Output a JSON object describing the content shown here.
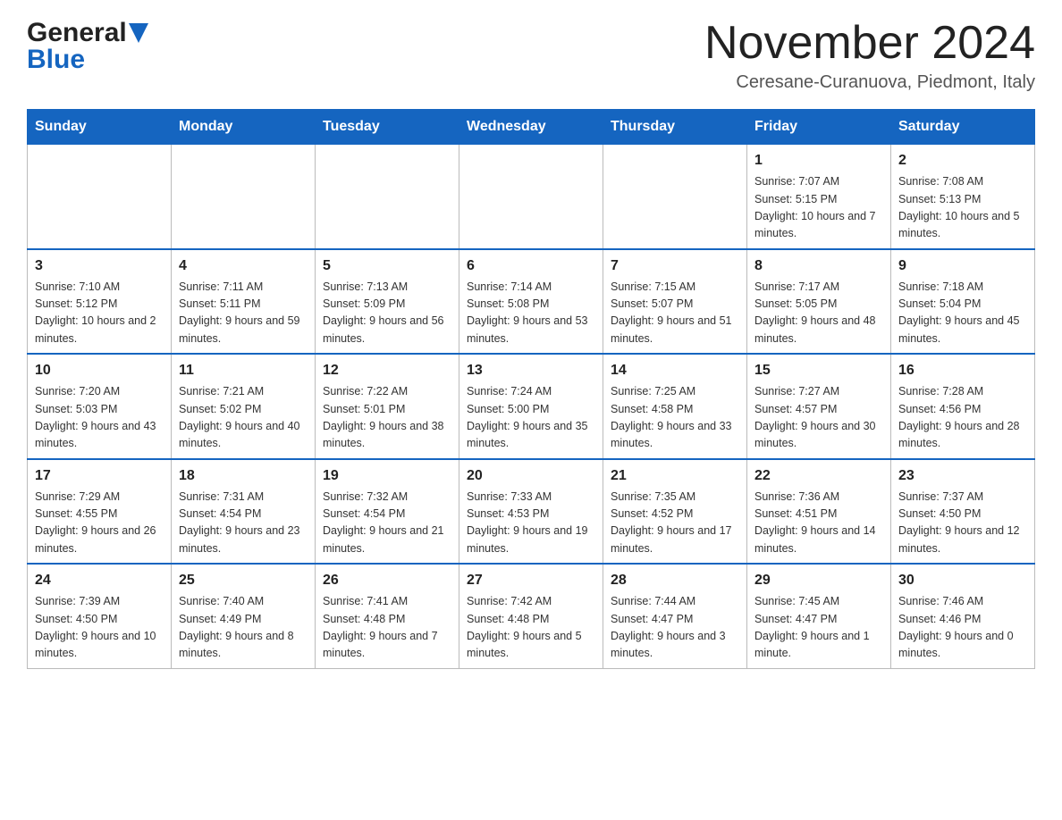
{
  "logo": {
    "general": "General",
    "blue": "Blue"
  },
  "title": "November 2024",
  "subtitle": "Ceresane-Curanuova, Piedmont, Italy",
  "header": {
    "days": [
      "Sunday",
      "Monday",
      "Tuesday",
      "Wednesday",
      "Thursday",
      "Friday",
      "Saturday"
    ]
  },
  "weeks": [
    [
      {
        "day": "",
        "info": ""
      },
      {
        "day": "",
        "info": ""
      },
      {
        "day": "",
        "info": ""
      },
      {
        "day": "",
        "info": ""
      },
      {
        "day": "",
        "info": ""
      },
      {
        "day": "1",
        "info": "Sunrise: 7:07 AM\nSunset: 5:15 PM\nDaylight: 10 hours and 7 minutes."
      },
      {
        "day": "2",
        "info": "Sunrise: 7:08 AM\nSunset: 5:13 PM\nDaylight: 10 hours and 5 minutes."
      }
    ],
    [
      {
        "day": "3",
        "info": "Sunrise: 7:10 AM\nSunset: 5:12 PM\nDaylight: 10 hours and 2 minutes."
      },
      {
        "day": "4",
        "info": "Sunrise: 7:11 AM\nSunset: 5:11 PM\nDaylight: 9 hours and 59 minutes."
      },
      {
        "day": "5",
        "info": "Sunrise: 7:13 AM\nSunset: 5:09 PM\nDaylight: 9 hours and 56 minutes."
      },
      {
        "day": "6",
        "info": "Sunrise: 7:14 AM\nSunset: 5:08 PM\nDaylight: 9 hours and 53 minutes."
      },
      {
        "day": "7",
        "info": "Sunrise: 7:15 AM\nSunset: 5:07 PM\nDaylight: 9 hours and 51 minutes."
      },
      {
        "day": "8",
        "info": "Sunrise: 7:17 AM\nSunset: 5:05 PM\nDaylight: 9 hours and 48 minutes."
      },
      {
        "day": "9",
        "info": "Sunrise: 7:18 AM\nSunset: 5:04 PM\nDaylight: 9 hours and 45 minutes."
      }
    ],
    [
      {
        "day": "10",
        "info": "Sunrise: 7:20 AM\nSunset: 5:03 PM\nDaylight: 9 hours and 43 minutes."
      },
      {
        "day": "11",
        "info": "Sunrise: 7:21 AM\nSunset: 5:02 PM\nDaylight: 9 hours and 40 minutes."
      },
      {
        "day": "12",
        "info": "Sunrise: 7:22 AM\nSunset: 5:01 PM\nDaylight: 9 hours and 38 minutes."
      },
      {
        "day": "13",
        "info": "Sunrise: 7:24 AM\nSunset: 5:00 PM\nDaylight: 9 hours and 35 minutes."
      },
      {
        "day": "14",
        "info": "Sunrise: 7:25 AM\nSunset: 4:58 PM\nDaylight: 9 hours and 33 minutes."
      },
      {
        "day": "15",
        "info": "Sunrise: 7:27 AM\nSunset: 4:57 PM\nDaylight: 9 hours and 30 minutes."
      },
      {
        "day": "16",
        "info": "Sunrise: 7:28 AM\nSunset: 4:56 PM\nDaylight: 9 hours and 28 minutes."
      }
    ],
    [
      {
        "day": "17",
        "info": "Sunrise: 7:29 AM\nSunset: 4:55 PM\nDaylight: 9 hours and 26 minutes."
      },
      {
        "day": "18",
        "info": "Sunrise: 7:31 AM\nSunset: 4:54 PM\nDaylight: 9 hours and 23 minutes."
      },
      {
        "day": "19",
        "info": "Sunrise: 7:32 AM\nSunset: 4:54 PM\nDaylight: 9 hours and 21 minutes."
      },
      {
        "day": "20",
        "info": "Sunrise: 7:33 AM\nSunset: 4:53 PM\nDaylight: 9 hours and 19 minutes."
      },
      {
        "day": "21",
        "info": "Sunrise: 7:35 AM\nSunset: 4:52 PM\nDaylight: 9 hours and 17 minutes."
      },
      {
        "day": "22",
        "info": "Sunrise: 7:36 AM\nSunset: 4:51 PM\nDaylight: 9 hours and 14 minutes."
      },
      {
        "day": "23",
        "info": "Sunrise: 7:37 AM\nSunset: 4:50 PM\nDaylight: 9 hours and 12 minutes."
      }
    ],
    [
      {
        "day": "24",
        "info": "Sunrise: 7:39 AM\nSunset: 4:50 PM\nDaylight: 9 hours and 10 minutes."
      },
      {
        "day": "25",
        "info": "Sunrise: 7:40 AM\nSunset: 4:49 PM\nDaylight: 9 hours and 8 minutes."
      },
      {
        "day": "26",
        "info": "Sunrise: 7:41 AM\nSunset: 4:48 PM\nDaylight: 9 hours and 7 minutes."
      },
      {
        "day": "27",
        "info": "Sunrise: 7:42 AM\nSunset: 4:48 PM\nDaylight: 9 hours and 5 minutes."
      },
      {
        "day": "28",
        "info": "Sunrise: 7:44 AM\nSunset: 4:47 PM\nDaylight: 9 hours and 3 minutes."
      },
      {
        "day": "29",
        "info": "Sunrise: 7:45 AM\nSunset: 4:47 PM\nDaylight: 9 hours and 1 minute."
      },
      {
        "day": "30",
        "info": "Sunrise: 7:46 AM\nSunset: 4:46 PM\nDaylight: 9 hours and 0 minutes."
      }
    ]
  ]
}
